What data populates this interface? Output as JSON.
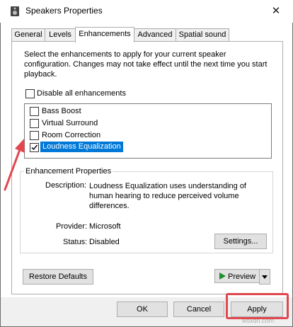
{
  "window": {
    "title": "Speakers Properties",
    "close_glyph": "✕"
  },
  "tabs": [
    "General",
    "Levels",
    "Enhancements",
    "Advanced",
    "Spatial sound"
  ],
  "active_tab": "Enhancements",
  "intro_text": "Select the enhancements to apply for your current speaker configuration. Changes may not take effect until the next time you start playback.",
  "disable_all": {
    "label": "Disable all enhancements",
    "checked": false
  },
  "enhancements": [
    {
      "label": "Bass Boost",
      "checked": false
    },
    {
      "label": "Virtual Surround",
      "checked": false
    },
    {
      "label": "Room Correction",
      "checked": false
    },
    {
      "label": "Loudness Equalization",
      "checked": true,
      "selected": true
    }
  ],
  "properties": {
    "title": "Enhancement Properties",
    "description_label": "Description:",
    "description_value": "Loudness Equalization uses understanding of human hearing to reduce perceived volume differences.",
    "provider_label": "Provider:",
    "provider_value": "Microsoft",
    "status_label": "Status:",
    "status_value": "Disabled",
    "settings_button": "Settings..."
  },
  "restore_button": "Restore Defaults",
  "preview_button": "Preview",
  "footer": {
    "ok": "OK",
    "cancel": "Cancel",
    "apply": "Apply"
  },
  "watermark": "wsxdn.com",
  "colors": {
    "selection": "#0078d7",
    "highlight_red": "#e1474f",
    "play_green": "#1e8f2e"
  }
}
